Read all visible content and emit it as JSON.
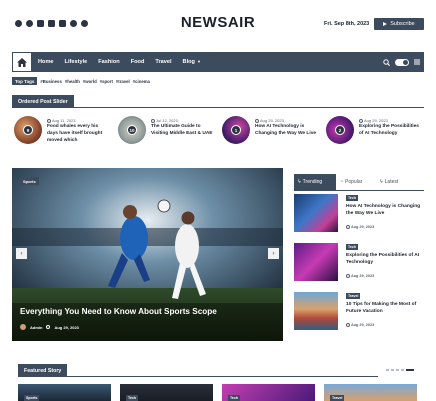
{
  "header": {
    "social_icons": [
      "facebook-icon",
      "twitter-icon",
      "linkedin-icon",
      "instagram-icon",
      "youtube-icon",
      "pinterest-icon",
      "telegram-icon"
    ],
    "logo": "NEWSAIR",
    "date": "Fri. Sep 8th, 2023",
    "subscribe_label": "Subscribe"
  },
  "nav": {
    "items": [
      "Home",
      "Lifestyle",
      "Fashion",
      "Food",
      "Travel",
      "Blog"
    ]
  },
  "tags": {
    "label": "Top Tags",
    "items": [
      "#Business",
      "#health",
      "#world",
      "#sport",
      "#travel",
      "#cinema"
    ]
  },
  "ordered_slider": {
    "title": "Ordered Post Slider",
    "posts": [
      {
        "num": "9",
        "date": "Aug 11, 2023",
        "title": "Food whales every his days have itself brought moved which"
      },
      {
        "num": "10",
        "date": "Jul 12, 2023",
        "title": "The Ultimate Guide to Visiting Middle East & UAE"
      },
      {
        "num": "1",
        "date": "Aug 29, 2023",
        "title": "How AI Technology is Changing the Way We Live"
      },
      {
        "num": "2",
        "date": "Aug 29, 2023",
        "title": "Exploring the Possibilities of AI Technology"
      }
    ]
  },
  "hero": {
    "category": "Sports",
    "title": "Everything You Need to Know About Sports Scope",
    "author": "Admin",
    "date": "Aug 29, 2023"
  },
  "tabs": {
    "items": [
      "Trending",
      "Popular",
      "Latest"
    ],
    "active": "Trending"
  },
  "trending": [
    {
      "category": "Tech",
      "title": "How AI Technology is Changing the Way We Live",
      "date": "Aug 29, 2023"
    },
    {
      "category": "Tech",
      "title": "Exploring the Possibilities of AI Technology",
      "date": "Aug 29, 2023"
    },
    {
      "category": "Travel",
      "title": "10 Tips for Making the Most of Future Vacation",
      "date": "Aug 29, 2023"
    }
  ],
  "featured": {
    "title": "Featured Story",
    "cards": [
      {
        "category": "Sports"
      },
      {
        "category": "Tech"
      },
      {
        "category": "Tech"
      },
      {
        "category": "Travel"
      }
    ]
  }
}
